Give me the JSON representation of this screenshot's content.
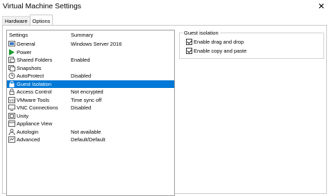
{
  "window": {
    "title": "Virtual Machine Settings",
    "close_glyph": "✕"
  },
  "tabs": [
    {
      "label": "Hardware",
      "active": false
    },
    {
      "label": "Options",
      "active": true
    }
  ],
  "settings_list": {
    "col_settings": "Settings",
    "col_summary": "Summary",
    "rows": [
      {
        "label": "General",
        "summary": "Windows Server 2016",
        "icon": "general-icon",
        "selected": false
      },
      {
        "label": "Power",
        "summary": "",
        "icon": "power-icon",
        "selected": false
      },
      {
        "label": "Shared Folders",
        "summary": "Enabled",
        "icon": "shared-folders-icon",
        "selected": false
      },
      {
        "label": "Snapshots",
        "summary": "",
        "icon": "snapshots-icon",
        "selected": false
      },
      {
        "label": "AutoProtect",
        "summary": "Disabled",
        "icon": "autoprotect-icon",
        "selected": false
      },
      {
        "label": "Guest Isolation",
        "summary": "",
        "icon": "lock-icon",
        "selected": true
      },
      {
        "label": "Access Control",
        "summary": "Not encrypted",
        "icon": "access-control-icon",
        "selected": false
      },
      {
        "label": "VMware Tools",
        "summary": "Time sync off",
        "icon": "vmware-tools-icon",
        "selected": false
      },
      {
        "label": "VNC Connections",
        "summary": "Disabled",
        "icon": "vnc-icon",
        "selected": false
      },
      {
        "label": "Unity",
        "summary": "",
        "icon": "unity-icon",
        "selected": false
      },
      {
        "label": "Appliance View",
        "summary": "",
        "icon": "appliance-view-icon",
        "selected": false
      },
      {
        "label": "Autologin",
        "summary": "Not available",
        "icon": "autologin-icon",
        "selected": false
      },
      {
        "label": "Advanced",
        "summary": "Default/Default",
        "icon": "advanced-icon",
        "selected": false
      }
    ]
  },
  "guest_isolation": {
    "group_title": "Guest isolation",
    "options": [
      {
        "label": "Enable drag and drop",
        "checked": true
      },
      {
        "label": "Enable copy and paste",
        "checked": true
      }
    ]
  },
  "colors": {
    "selection": "#0078d7",
    "power_green": "#1e9a2e"
  }
}
